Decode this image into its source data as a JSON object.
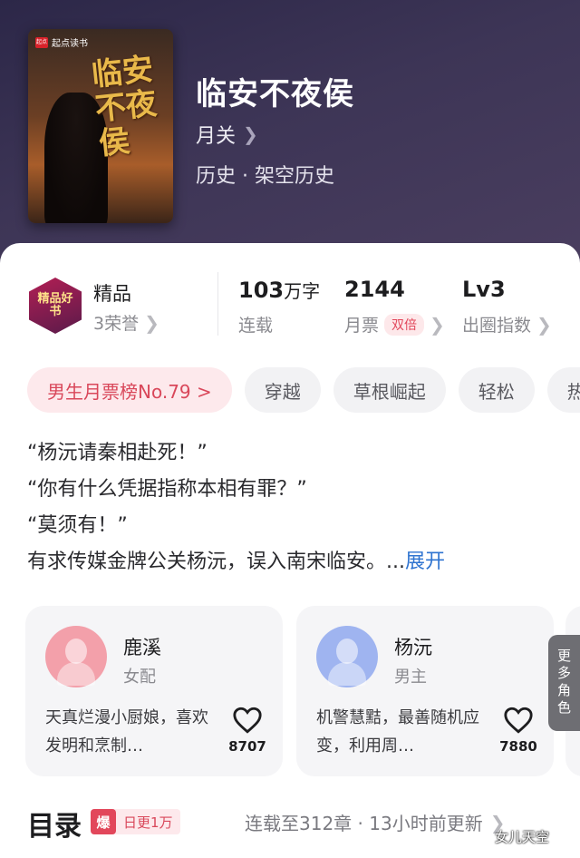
{
  "book": {
    "cover_brand": "起点读书",
    "cover_logo": "起点",
    "cover_title": "临安不夜侯",
    "title": "临安不夜侯",
    "author": "月关",
    "genre": "历史 · 架空历史"
  },
  "stats": {
    "quality_badge": "精品好书",
    "quality_label": "精品",
    "honors": "3荣誉",
    "word_count": "103",
    "word_unit": "万字",
    "status": "连载",
    "monthly_votes": "2144",
    "monthly_votes_label": "月票",
    "double_tag": "双倍",
    "level": "Lv3",
    "level_label": "出圈指数"
  },
  "tags": {
    "rank": "男生月票榜No.79 >",
    "t1": "穿越",
    "t2": "草根崛起",
    "t3": "轻松",
    "t4": "热"
  },
  "description": {
    "line1": "“杨沅请秦相赴死！”",
    "line2": "“你有什么凭据指称本相有罪？”",
    "line3": "“莫须有！”",
    "line4": "有求传媒金牌公关杨沅，误入南宋临安。...",
    "expand": "展开"
  },
  "roles": [
    {
      "name": "鹿溪",
      "type": "女配",
      "desc": "天真烂漫小厨娘，喜欢发明和烹制…",
      "likes": "8707",
      "color": "#f3a0aa"
    },
    {
      "name": "杨沅",
      "type": "男主",
      "desc": "机警慧黠，最善随机应变，利用周…",
      "likes": "7880",
      "color": "#9fb4f0"
    }
  ],
  "more_roles": "更多角色",
  "toc": {
    "title": "目录",
    "hot_icon": "爆",
    "hot_text": "日更1万",
    "status": "连载至312章 · 13小时前更新"
  },
  "watermark": "女儿天空",
  "colors": {
    "accent_red": "#e2475b",
    "link_blue": "#2f74d0"
  }
}
